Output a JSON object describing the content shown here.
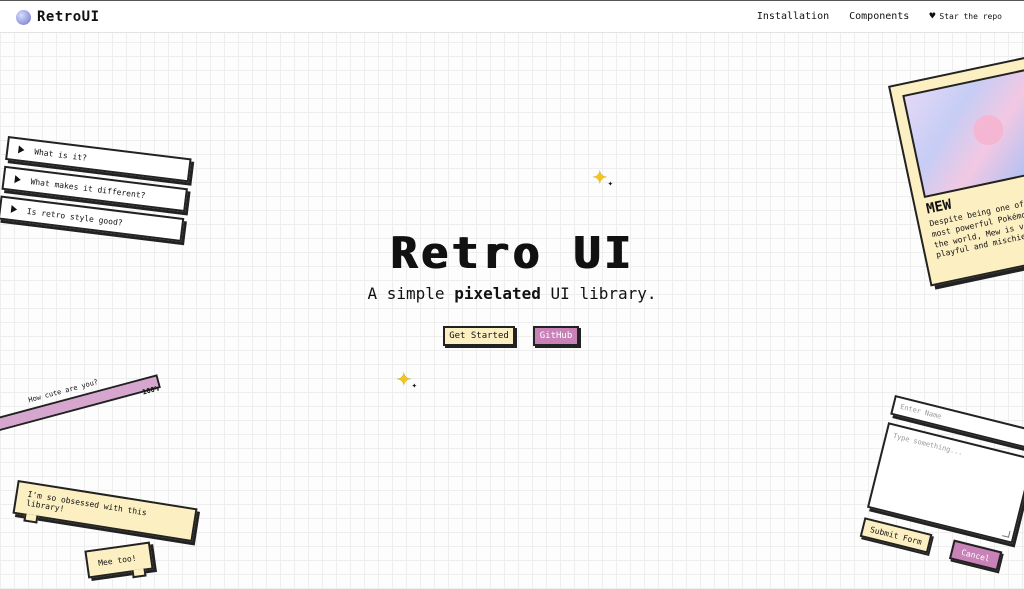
{
  "nav": {
    "logo_text": "RetroUI",
    "links": [
      "Installation",
      "Components"
    ],
    "star_label": "Star the repo"
  },
  "hero": {
    "title": "Retro UI",
    "subtitle_pre": "A simple ",
    "subtitle_bold": "pixelated",
    "subtitle_post": " UI library.",
    "primary_button": "Get Started",
    "secondary_button": "GitHub"
  },
  "accordion": {
    "items": [
      "What is it?",
      "What makes it different?",
      "Is retro style good?"
    ]
  },
  "progress": {
    "label": "How cute are you?",
    "value": 100,
    "value_label": "100%"
  },
  "chat": {
    "message1": "I'm so obsessed with this library!",
    "message2": "Mee too!"
  },
  "card": {
    "title": "MEW",
    "description": "Despite being one of the most powerful Pokémon in the world, Mew is very playful and mischievous."
  },
  "form": {
    "name_placeholder": "Enter Name",
    "message_placeholder": "Type something...",
    "submit_label": "Submit Form",
    "cancel_label": "Cancel"
  },
  "colors": {
    "cream": "#fcefc2",
    "pink": "#c882b8",
    "border": "#222222"
  }
}
